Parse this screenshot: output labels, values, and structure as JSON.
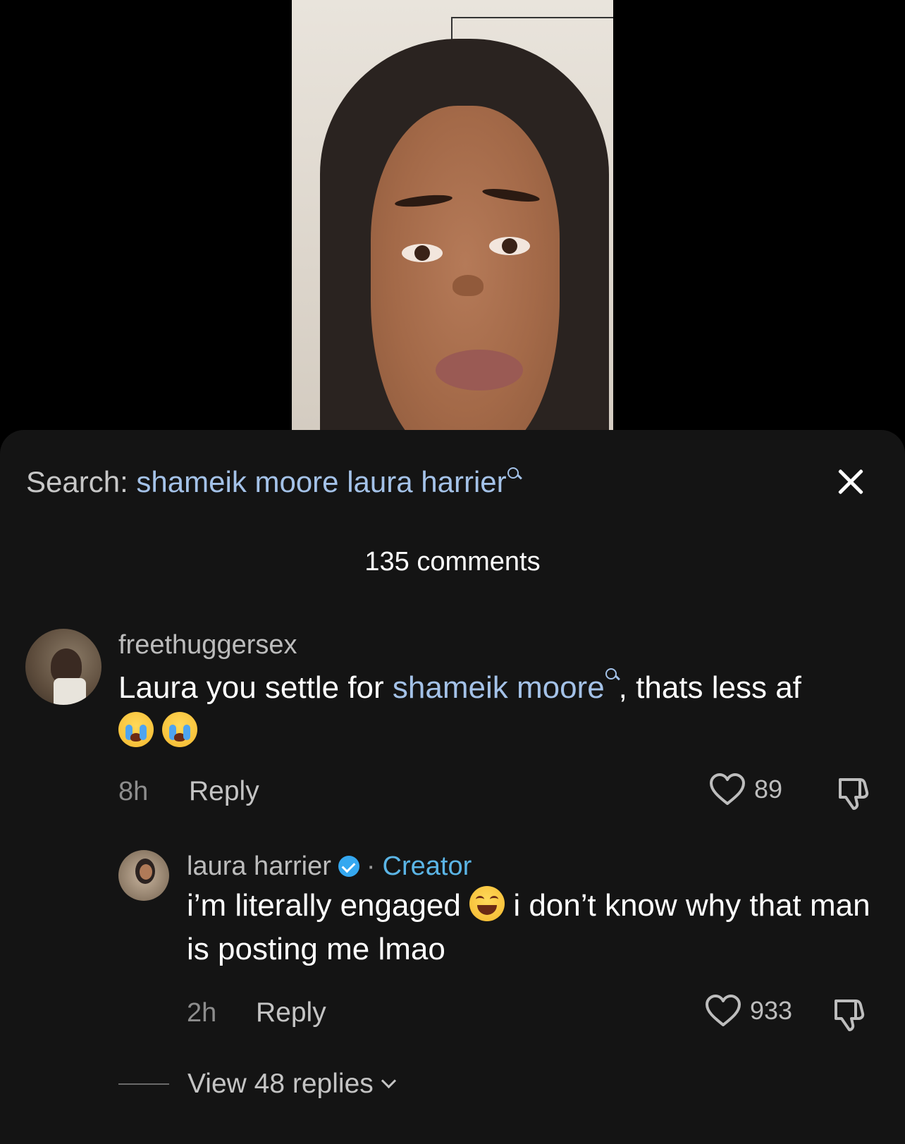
{
  "search": {
    "label": "Search:",
    "term": "shameik moore laura harrier"
  },
  "comments_header": {
    "count_text": "135 comments"
  },
  "comments": [
    {
      "username": "freethuggersex",
      "text_before": "Laura you settle for ",
      "mention": "shameik moore",
      "text_after": ", thats less af",
      "emojis": [
        "loudly-crying-face",
        "loudly-crying-face"
      ],
      "time": "8h",
      "reply_label": "Reply",
      "likes": "89"
    },
    {
      "username": "laura harrier",
      "separator": "·",
      "badge": "Creator",
      "text_before": "i’m literally engaged ",
      "emoji": "face-with-tears-of-joy",
      "text_after": " i don’t know why that man is posting me lmao",
      "time": "2h",
      "reply_label": "Reply",
      "likes": "933"
    }
  ],
  "view_replies": "View 48 replies",
  "colors": {
    "sheet_bg": "#141414",
    "mention": "#a4c2e8",
    "creator": "#5bb5e6",
    "verified": "#35a8f0"
  },
  "icons": [
    "search-glyph-icon",
    "close-icon",
    "heart-icon",
    "dislike-icon",
    "verified-icon",
    "chevron-down-icon"
  ]
}
